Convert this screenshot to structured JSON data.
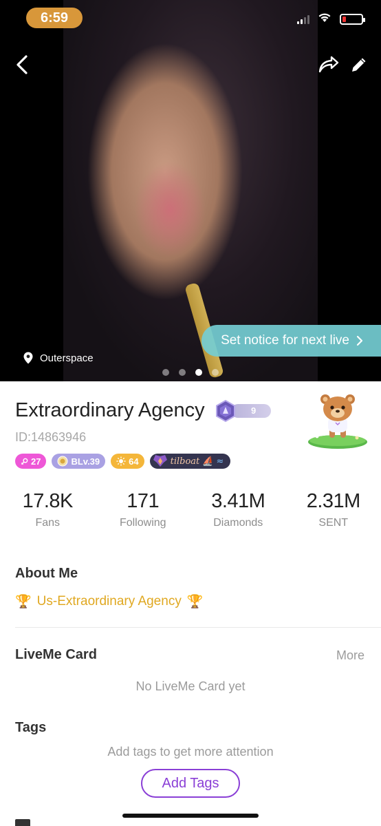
{
  "status_bar": {
    "time": "6:59",
    "battery_level": 0.15,
    "icons": [
      "cellular-signal-icon",
      "wifi-icon",
      "battery-low-icon"
    ]
  },
  "header": {
    "back_icon": "chevron-left-icon",
    "share_icon": "share-arrow-icon",
    "edit_icon": "pencil-icon"
  },
  "hero": {
    "notice_label": "Set notice for next live",
    "location": "Outerspace",
    "photo_count": 4,
    "active_photo": 3
  },
  "profile": {
    "name": "Extraordinary Agency",
    "level": "9",
    "id": "ID:14863946",
    "badges": {
      "gender": "27",
      "blv": "BLv.39",
      "sun": "64",
      "family": "tilboat"
    }
  },
  "stats": [
    {
      "value": "17.8K",
      "label": "Fans"
    },
    {
      "value": "171",
      "label": "Following"
    },
    {
      "value": "3.41M",
      "label": "Diamonds"
    },
    {
      "value": "2.31M",
      "label": "SENT"
    }
  ],
  "about": {
    "title": "About Me",
    "text": "Us-Extraordinary Agency"
  },
  "card": {
    "title": "LiveMe Card",
    "more": "More",
    "empty": "No LiveMe Card yet"
  },
  "tags": {
    "title": "Tags",
    "hint": "Add tags to get more attention",
    "button": "Add Tags"
  },
  "colors": {
    "accent_purple": "#8a3fd6",
    "notice_teal": "#74cdd2",
    "gold": "#e0a821",
    "time_pill": "#d8973a"
  }
}
